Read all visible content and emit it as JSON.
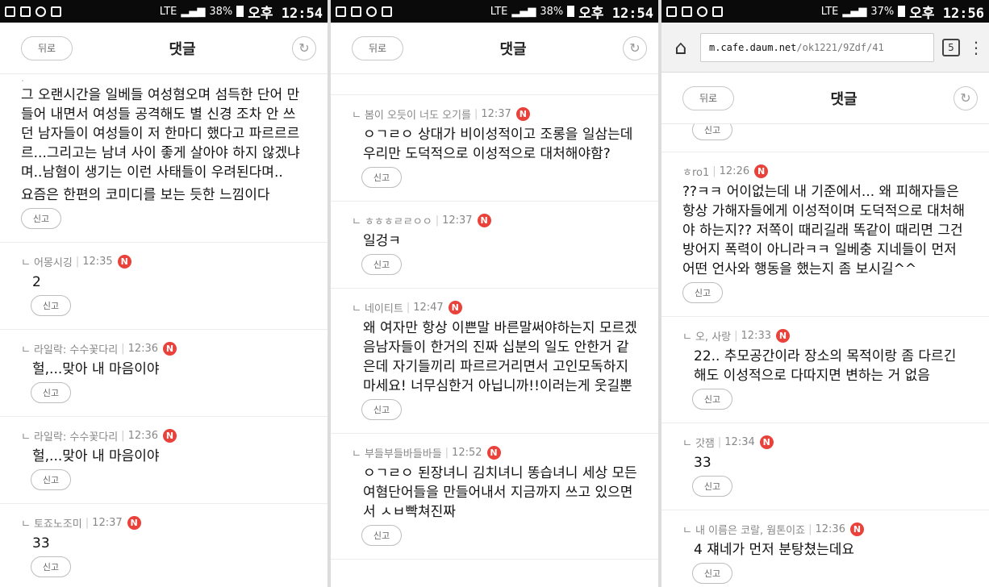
{
  "status_bar": {
    "battery_1": "38%",
    "battery_3": "37%",
    "time_1": "오후 12:54",
    "time_3": "오후 12:56",
    "network": "LTE"
  },
  "header": {
    "back_label": "뒤로",
    "title": "댓글"
  },
  "browser": {
    "url_host": "m.cafe.daum.net",
    "url_path": "/ok1221/9Zdf/41",
    "tabs_count": "5"
  },
  "report_label": "신고",
  "new_badge": "N",
  "panel1": {
    "top_comment": {
      "body": "그 오랜시간을 일베들 여성혐오며 섬득한 단어 만들어 내면서 여성들 공격해도 별 신경 조차 안 쓰던 남자들이 여성들이 저 한마디 했다고 파르르르르...그리고는 남녀 사이 좋게 살아야 하지 않겠냐며..남혐이 생기는 이런 사태들이 우려된다며..",
      "body2": "요즘은 한편의 코미디를 보는 듯한 느낌이다"
    },
    "comments": [
      {
        "author": "어몽시깅",
        "time": "12:35",
        "body": "2"
      },
      {
        "author": "라일락: 수수꽃다리",
        "time": "12:36",
        "body": "헐,...맞아 내 마음이야"
      },
      {
        "author": "라일락: 수수꽃다리",
        "time": "12:36",
        "body": "헐,...맞아 내 마음이야"
      },
      {
        "author": "토죠노조미",
        "time": "12:37",
        "body": "33"
      }
    ]
  },
  "panel2": {
    "comments": [
      {
        "author": "봄이 오듯이 너도 오기를",
        "time": "12:37",
        "body": "ㅇㄱㄹㅇ 상대가 비이성적이고 조롱을 일삼는데 우리만 도덕적으로 이성적으로 대처해야함?"
      },
      {
        "author": "ㅎㅎㅎㄹㄹㅇㅇ",
        "time": "12:37",
        "body": "일겅ㅋ"
      },
      {
        "author": "네이티트",
        "time": "12:47",
        "body": "왜 여자만 항상 이쁜말 바른말써야하는지 모르겠음남자들이 한거의 진짜 십분의 일도 안한거 같은데 자기들끼리 파르르거리면서 고인모독하지마세요! 너무심한거 아닙니까!!이러는게 웃길뿐"
      },
      {
        "author": "부들부들바들바들",
        "time": "12:52",
        "body": "ㅇㄱㄹㅇ 된장녀니 김치녀니 똥습녀니 세상 모든 여혐단어들을 만들어내서 지금까지 쓰고 있으면서 ㅅㅂ빡쳐진짜"
      }
    ]
  },
  "panel3": {
    "comments": [
      {
        "author": "ㅎro1",
        "time": "12:26",
        "body": "??ㅋㅋ 어이없는데 내 기준에서... 왜 피해자들은 항상 가해자들에게 이성적이며 도덕적으로 대처해야 하는지?? 저쪽이 때리길래 똑같이 때리면 그건 방어지 폭력이 아니라ㅋㅋ 일베충 지네들이 먼저 어떤 언사와 행동을 했는지 좀 보시길^^"
      },
      {
        "author": "오, 사랑",
        "time": "12:33",
        "body": "22.. 추모공간이라 장소의 목적이랑 좀 다르긴 해도 이성적으로 다따지면 변하는 거 없음"
      },
      {
        "author": "갓잼",
        "time": "12:34",
        "body": "33"
      },
      {
        "author": "내 이름은 코랄, 웜톤이죠",
        "time": "12:36",
        "body": "4 쟤네가 먼저 분탕쳤는데요"
      }
    ]
  }
}
